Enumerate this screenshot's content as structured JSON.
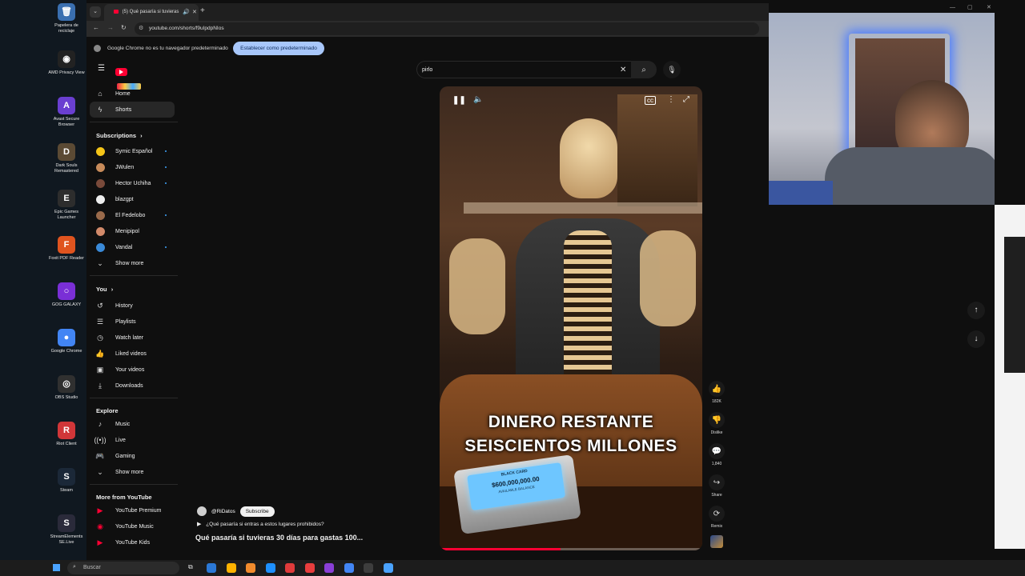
{
  "desktop": {
    "icons": [
      {
        "label": "Papelera de reciclaje",
        "icon": "recycle-bin-icon",
        "color": "#3a6fb0",
        "glyph": "🗑"
      },
      {
        "label": "AMD Privacy View",
        "icon": "amd-privacy-icon",
        "color": "#222222",
        "glyph": "◉"
      },
      {
        "label": "Avast Secure Browser",
        "icon": "avast-browser-icon",
        "color": "#6a3fd1",
        "glyph": "A"
      },
      {
        "label": "Dark Souls Remastered",
        "icon": "dark-souls-icon",
        "color": "#5b4a34",
        "glyph": "D"
      },
      {
        "label": "Epic Games Launcher",
        "icon": "epic-games-icon",
        "color": "#2d2d2d",
        "glyph": "E"
      },
      {
        "label": "Foxit PDF Reader",
        "icon": "foxit-pdf-icon",
        "color": "#e0541f",
        "glyph": "F"
      },
      {
        "label": "GOG GALAXY",
        "icon": "gog-galaxy-icon",
        "color": "#7a2fd6",
        "glyph": "○"
      },
      {
        "label": "Google Chrome",
        "icon": "google-chrome-icon",
        "color": "#4285f4",
        "glyph": "●"
      },
      {
        "label": "OBS Studio",
        "icon": "obs-studio-icon",
        "color": "#303030",
        "glyph": "◎"
      },
      {
        "label": "Riot Client",
        "icon": "riot-client-icon",
        "color": "#d13639",
        "glyph": "R"
      },
      {
        "label": "Steam",
        "icon": "steam-icon",
        "color": "#1b2838",
        "glyph": "S"
      },
      {
        "label": "StreamElements SE.Live",
        "icon": "streamelements-icon",
        "color": "#2a2a3a",
        "glyph": "S"
      }
    ]
  },
  "browser": {
    "tab_title": "(5) Qué pasaría si tuvieras",
    "url": "youtube.com/shorts/f9uIpdpNIos",
    "infobar_text": "Google Chrome no es tu navegador predeterminado",
    "infobar_button": "Establecer como predeterminado"
  },
  "youtube": {
    "search_value": "pirlo",
    "nav_main": [
      {
        "label": "Home",
        "icon": "home-icon",
        "glyph": "⌂"
      },
      {
        "label": "Shorts",
        "icon": "shorts-icon",
        "glyph": "ϟ"
      }
    ],
    "subscriptions_title": "Subscriptions",
    "subscriptions": [
      {
        "label": "Symic Español",
        "color": "#f5c518"
      },
      {
        "label": "JWulen",
        "color": "#c88b5a"
      },
      {
        "label": "Hector Uchiha",
        "color": "#7a4a3a"
      },
      {
        "label": "blazgpt",
        "color": "#eeeeee"
      },
      {
        "label": "El Fedelobo",
        "color": "#9a6a4a"
      },
      {
        "label": "Menipipol",
        "color": "#d28a6a"
      },
      {
        "label": "Vandal",
        "color": "#3a8ad8"
      }
    ],
    "subs_show_more": "Show more",
    "you_title": "You",
    "you_items": [
      {
        "label": "History",
        "icon": "history-icon",
        "glyph": "↺"
      },
      {
        "label": "Playlists",
        "icon": "playlists-icon",
        "glyph": "☰"
      },
      {
        "label": "Watch later",
        "icon": "watch-later-icon",
        "glyph": "◷"
      },
      {
        "label": "Liked videos",
        "icon": "liked-videos-icon",
        "glyph": "👍"
      },
      {
        "label": "Your videos",
        "icon": "your-videos-icon",
        "glyph": "▣"
      },
      {
        "label": "Downloads",
        "icon": "downloads-icon",
        "glyph": "⤓"
      }
    ],
    "explore_title": "Explore",
    "explore_items": [
      {
        "label": "Music",
        "icon": "music-icon",
        "glyph": "♪"
      },
      {
        "label": "Live",
        "icon": "live-icon",
        "glyph": "((•))"
      },
      {
        "label": "Gaming",
        "icon": "gaming-icon",
        "glyph": "🎮"
      }
    ],
    "explore_show_more": "Show more",
    "more_title": "More from YouTube",
    "more_items": [
      {
        "label": "YouTube Premium"
      },
      {
        "label": "YouTube Music"
      },
      {
        "label": "YouTube Kids"
      }
    ],
    "short": {
      "caption_line1": "DINERO RESTANTE",
      "caption_line2": "SEISCIENTOS MILLONES",
      "card_amount": "$600,000,000.00",
      "card_header": "BLACK CARD",
      "card_subtext": "AVAILABLE BALANCE",
      "channel": "@RiDatos",
      "subscribe_label": "Subscribe",
      "playlist_label": "¿Qué pasaría si entras a estos lugares prohibidos?",
      "title": "Qué pasaría si tuvieras 30 días para gastas 100...",
      "likes": "182K",
      "dislike_label": "Dislike",
      "comments": "1,840",
      "share_label": "Share",
      "remix_label": "Remix",
      "progress_fraction": 0.46
    }
  },
  "taskbar": {
    "search_placeholder": "Buscar",
    "apps": [
      "#2b78d6",
      "#ffb300",
      "#f28b2d",
      "#1e90ff",
      "#e03b3b",
      "#e83d3d",
      "#8a3fd6",
      "#4285f4",
      "#3d3d3d",
      "#4aa3ff"
    ]
  },
  "colors": {
    "accent_red": "#ff0033",
    "link_blue": "#3ea6ff",
    "infobar_button": "#a8c7fa"
  }
}
